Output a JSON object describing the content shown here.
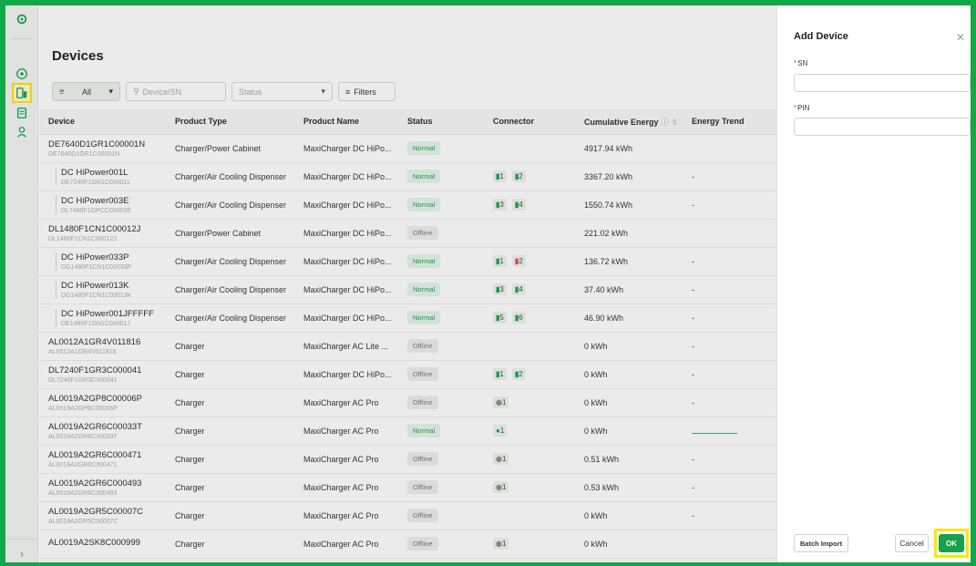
{
  "page": {
    "title": "Devices"
  },
  "toolbar": {
    "all_label": "All",
    "search_placeholder": "Device/SN",
    "status_placeholder": "Status",
    "filters_label": "Filters"
  },
  "table": {
    "columns": [
      "Device",
      "Product Type",
      "Product Name",
      "Status",
      "Connector",
      "Cumulative Energy",
      "Energy Trend"
    ],
    "rows": [
      {
        "sn": "DE7640D1GR1C00001N",
        "sub": "DE7640D1GR1C00001N",
        "child": false,
        "type": "Charger/Power Cabinet",
        "name": "MaxiCharger DC HiPo...",
        "status": "Normal",
        "connectors": [],
        "energy": "4917.94 kWh",
        "trend": ""
      },
      {
        "sn": "DC HiPower001L",
        "sub": "DE7240F1GR1C00001L",
        "child": true,
        "type": "Charger/Air Cooling Dispenser",
        "name": "MaxiCharger DC HiPo...",
        "status": "Normal",
        "connectors": [
          {
            "n": "1",
            "c": "green"
          },
          {
            "n": "2",
            "c": "green"
          }
        ],
        "energy": "3367.20 kWh",
        "trend": "-"
      },
      {
        "sn": "DC HiPower003E",
        "sub": "DL7480F1GPCC00003E",
        "child": true,
        "type": "Charger/Air Cooling Dispenser",
        "name": "MaxiCharger DC HiPo...",
        "status": "Normal",
        "connectors": [
          {
            "n": "3",
            "c": "green"
          },
          {
            "n": "4",
            "c": "green"
          }
        ],
        "energy": "1550.74 kWh",
        "trend": "-"
      },
      {
        "sn": "DL1480F1CN1C00012J",
        "sub": "DL1480F1CN1C00012J",
        "child": false,
        "type": "Charger/Power Cabinet",
        "name": "MaxiCharger DC HiPo...",
        "status": "Offline",
        "connectors": [],
        "energy": "221.02 kWh",
        "trend": ""
      },
      {
        "sn": "DC HiPower033P",
        "sub": "DG1480F1CN1C00033P",
        "child": true,
        "type": "Charger/Air Cooling Dispenser",
        "name": "MaxiCharger DC HiPo...",
        "status": "Normal",
        "connectors": [
          {
            "n": "1",
            "c": "green"
          },
          {
            "n": "2",
            "c": "red"
          }
        ],
        "energy": "136.72 kWh",
        "trend": "-"
      },
      {
        "sn": "DC HiPower013K",
        "sub": "DG1480F1CN1C00013K",
        "child": true,
        "type": "Charger/Air Cooling Dispenser",
        "name": "MaxiCharger DC HiPo...",
        "status": "Normal",
        "connectors": [
          {
            "n": "3",
            "c": "green"
          },
          {
            "n": "4",
            "c": "green"
          }
        ],
        "energy": "37.40 kWh",
        "trend": "-"
      },
      {
        "sn": "DC HiPower001JFFFFF",
        "sub": "DE1480F1GN1C00001J",
        "child": true,
        "type": "Charger/Air Cooling Dispenser",
        "name": "MaxiCharger DC HiPo...",
        "status": "Normal",
        "connectors": [
          {
            "n": "5",
            "c": "green"
          },
          {
            "n": "6",
            "c": "green"
          }
        ],
        "energy": "46.90 kWh",
        "trend": "-"
      },
      {
        "sn": "AL0012A1GR4V011816",
        "sub": "AL0012A1GR4V011816",
        "child": false,
        "type": "Charger",
        "name": "MaxiCharger AC Lite ...",
        "status": "Offline",
        "connectors": [],
        "energy": "0 kWh",
        "trend": "-"
      },
      {
        "sn": "DL7240F1GR3C000041",
        "sub": "DL7240F1GR3C000041",
        "child": false,
        "type": "Charger",
        "name": "MaxiCharger DC HiPo...",
        "status": "Offline",
        "connectors": [
          {
            "n": "1",
            "c": "green"
          },
          {
            "n": "2",
            "c": "green"
          }
        ],
        "energy": "0 kWh",
        "trend": "-"
      },
      {
        "sn": "AL0019A2GP8C00006P",
        "sub": "AL0019A2GP8C00006P",
        "child": false,
        "type": "Charger",
        "name": "MaxiCharger AC Pro",
        "status": "Offline",
        "connectors": [
          {
            "n": "1",
            "c": "dot"
          }
        ],
        "energy": "0 kWh",
        "trend": "-"
      },
      {
        "sn": "AL0019A2GR6C00033T",
        "sub": "AL0019A2GR6C00033T",
        "child": false,
        "type": "Charger",
        "name": "MaxiCharger AC Pro",
        "status": "Normal",
        "connectors": [
          {
            "n": "1",
            "c": "dotgreen"
          }
        ],
        "energy": "0 kWh",
        "trend": "line"
      },
      {
        "sn": "AL0019A2GR6C000471",
        "sub": "AL0019A2GR6C000471",
        "child": false,
        "type": "Charger",
        "name": "MaxiCharger AC Pro",
        "status": "Offline",
        "connectors": [
          {
            "n": "1",
            "c": "dot"
          }
        ],
        "energy": "0.51 kWh",
        "trend": "-"
      },
      {
        "sn": "AL0019A2GR6C000493",
        "sub": "AL0019A2GR6C000493",
        "child": false,
        "type": "Charger",
        "name": "MaxiCharger AC Pro",
        "status": "Offline",
        "connectors": [
          {
            "n": "1",
            "c": "dot"
          }
        ],
        "energy": "0.53 kWh",
        "trend": "-"
      },
      {
        "sn": "AL0019A2GR5C00007C",
        "sub": "AL0019A2GR5C00007C",
        "child": false,
        "type": "Charger",
        "name": "MaxiCharger AC Pro",
        "status": "Offline",
        "connectors": [],
        "energy": "0 kWh",
        "trend": "-"
      },
      {
        "sn": "AL0019A2SK8C000999",
        "sub": "",
        "child": false,
        "type": "Charger",
        "name": "MaxiCharger AC Pro",
        "status": "Offline",
        "connectors": [
          {
            "n": "1",
            "c": "dot"
          }
        ],
        "energy": "0 kWh",
        "trend": ""
      }
    ]
  },
  "drawer": {
    "title": "Add Device",
    "close_icon": "close-icon",
    "sn_label": "SN",
    "pin_label": "PIN",
    "batch_import_label": "Batch Import",
    "cancel_label": "Cancel",
    "ok_label": "OK"
  },
  "colors": {
    "brand": "#18a04a",
    "highlight": "#ffe600",
    "frame": "#12a84a"
  }
}
